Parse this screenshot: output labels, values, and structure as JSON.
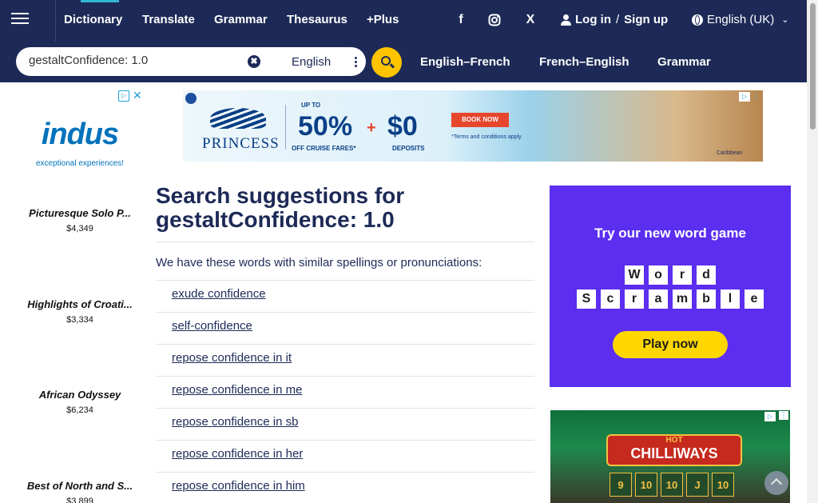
{
  "nav": {
    "dictionary": "Dictionary",
    "translate": "Translate",
    "grammar": "Grammar",
    "thesaurus": "Thesaurus",
    "plus": "+Plus",
    "login": "Log in",
    "slash": "/",
    "signup": "Sign up",
    "language": "English (UK)",
    "social": {
      "facebook": "f",
      "x": "X"
    }
  },
  "search": {
    "value": "gestaltConfidence: 1.0",
    "dictionary": "English",
    "quick_links": [
      "English–French",
      "French–English",
      "Grammar"
    ]
  },
  "left_ad": {
    "brand": "indus",
    "tagline": "exceptional experiences!",
    "tours": [
      {
        "name": "Picturesque Solo P...",
        "price": "$4,349"
      },
      {
        "name": "Highlights of Croati...",
        "price": "$3,334"
      },
      {
        "name": "African Odyssey",
        "price": "$6,234"
      },
      {
        "name": "Best of North and S...",
        "price": "$3,899"
      }
    ]
  },
  "banner_ad": {
    "brand": "PRINCESS",
    "up_to": "UP TO",
    "discount": "50%",
    "discount_text": "OFF CRUISE FARES*",
    "deposit": "$0",
    "deposit_text": "DEPOSITS",
    "cta": "BOOK NOW",
    "terms": "*Terms and conditions apply.",
    "region": "Caribbean"
  },
  "main": {
    "heading_prefix": "Search suggestions for",
    "query": "gestaltConfidence: 1.0",
    "intro": "We have these words with similar spellings or pronunciations:",
    "suggestions": [
      "exude confidence",
      "self-confidence",
      "repose confidence in it",
      "repose confidence in me",
      "repose confidence in sb",
      "repose confidence in her",
      "repose confidence in him"
    ]
  },
  "game_ad": {
    "title": "Try our new word game",
    "row1": [
      "W",
      "o",
      "r",
      "d"
    ],
    "row2": [
      "S",
      "c",
      "r",
      "a",
      "m",
      "b",
      "l",
      "e"
    ],
    "cta": "Play now"
  },
  "casino_ad": {
    "hot": "HOT",
    "title": "CHILLIWAYS",
    "reels": [
      "9",
      "10",
      "10",
      "J",
      "10"
    ]
  },
  "colors": {
    "navy": "#1d2a57",
    "accent_yellow": "#fec400",
    "accent_blue": "#33b5d6",
    "game_purple": "#5b2ef0"
  }
}
